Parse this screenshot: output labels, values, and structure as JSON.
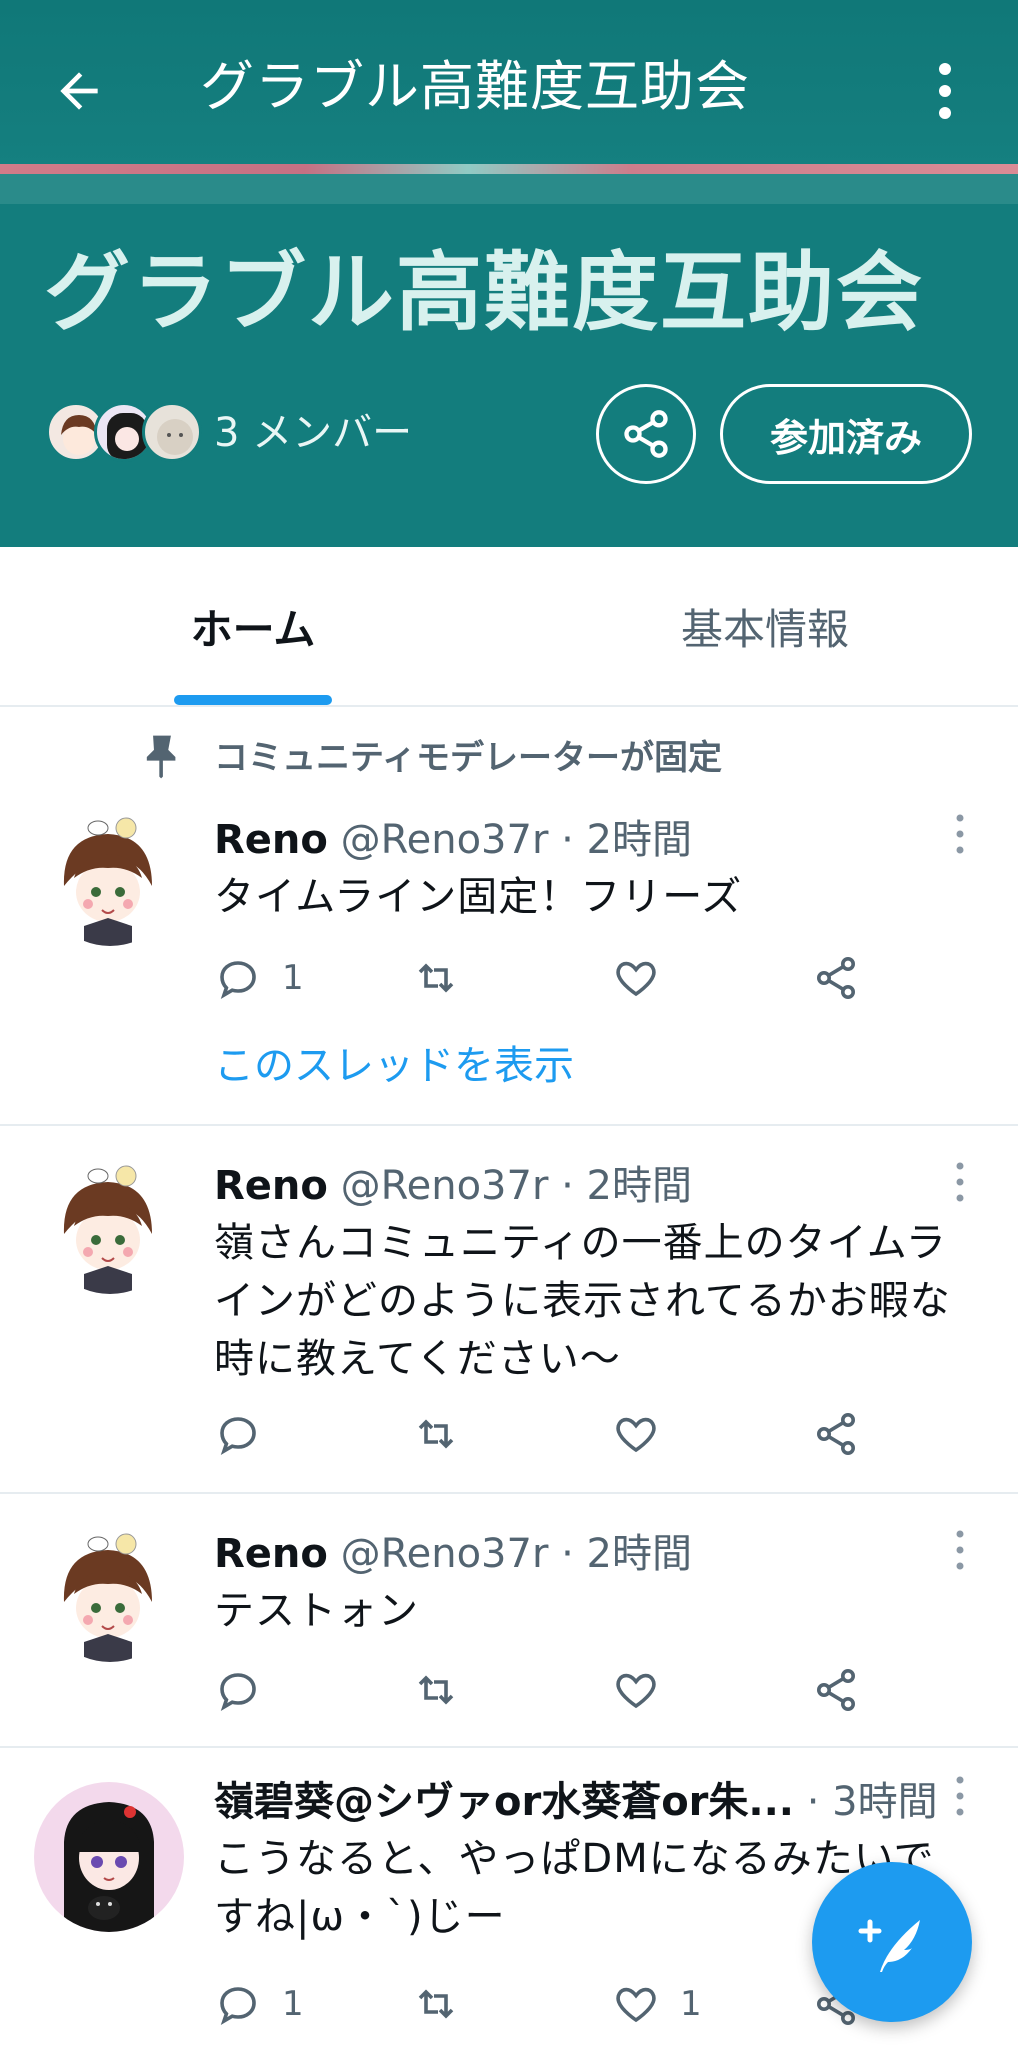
{
  "topbar": {
    "title": "グラブル高難度互助会"
  },
  "community": {
    "title": "グラブル高難度互助会",
    "members_label": "3 メンバー",
    "joined_label": "参加済み"
  },
  "tabs": [
    {
      "label": "ホーム",
      "selected": true
    },
    {
      "label": "基本情報",
      "selected": false
    }
  ],
  "pinned": {
    "label": "コミュニティモデレーターが固定"
  },
  "tweets": [
    {
      "name": "Reno",
      "handle": "@Reno37r",
      "time": "· 2時間",
      "text": "タイムライン固定！フリーズ",
      "reply_count": "1",
      "like_count": "",
      "thread_link": "このスレッドを表示"
    },
    {
      "name": "Reno",
      "handle": "@Reno37r",
      "time": "· 2時間",
      "text": "嶺さんコミュニティの一番上のタイムラインがどのように表示されてるかお暇な時に教えてください〜",
      "reply_count": "",
      "like_count": ""
    },
    {
      "name": "Reno",
      "handle": "@Reno37r",
      "time": "· 2時間",
      "text": "テストォン",
      "reply_count": "",
      "like_count": ""
    },
    {
      "name": "嶺碧葵@シヴァor水葵蒼or朱...",
      "handle": "",
      "time": "· 3時間",
      "text": "こうなると、やっぱDMになるみたいですね|ω・`)じー",
      "reply_count": "1",
      "like_count": "1"
    }
  ],
  "colors": {
    "header_bg": "#137d7d",
    "accent": "#1d9bf0",
    "secondary_text": "#536471"
  },
  "icons": [
    "back-arrow-icon",
    "more-vertical-icon",
    "share-icon",
    "pin-icon",
    "reply-icon",
    "retweet-icon",
    "like-icon",
    "compose-icon"
  ]
}
